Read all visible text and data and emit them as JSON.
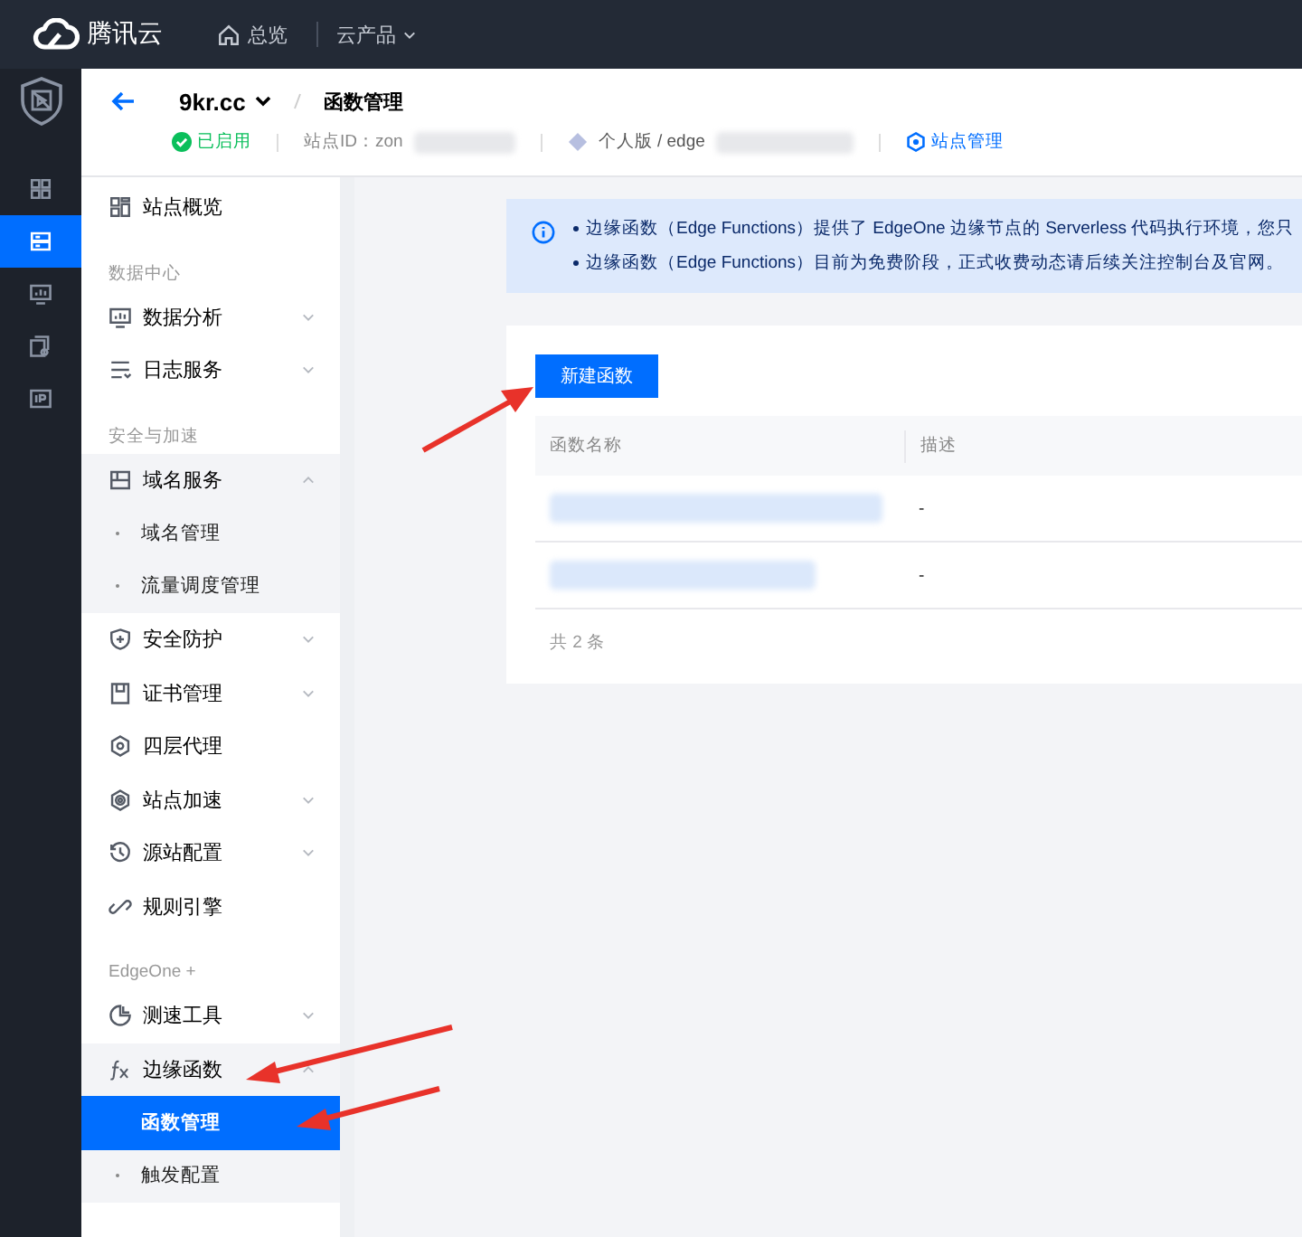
{
  "topbar": {
    "brand": "腾讯云",
    "nav": [
      {
        "label": "总览",
        "kind": "home"
      },
      {
        "label": "云产品",
        "kind": "dropdown"
      }
    ]
  },
  "header": {
    "site": "9kr.cc",
    "page": "函数管理",
    "status": "已启用",
    "zone_label": "站点ID：",
    "zone_id": "zon",
    "plan": "个人版 / edge",
    "manage_link": "站点管理"
  },
  "rail": [
    {
      "selected": false
    },
    {
      "selected": true
    },
    {
      "selected": false
    },
    {
      "selected": false
    },
    {
      "selected": false
    }
  ],
  "sidebar": [
    {
      "kind": "item",
      "label": "站点概览"
    },
    {
      "kind": "label",
      "label": "数据中心"
    },
    {
      "kind": "item",
      "label": "数据分析",
      "expanded": false
    },
    {
      "kind": "item",
      "label": "日志服务",
      "expanded": false
    },
    {
      "kind": "label",
      "label": "安全与加速"
    },
    {
      "kind": "item",
      "label": "域名服务",
      "expanded": true,
      "children": [
        {
          "label": "域名管理",
          "selected": false
        },
        {
          "label": "流量调度管理",
          "selected": false
        }
      ]
    },
    {
      "kind": "item",
      "label": "安全防护",
      "expanded": false
    },
    {
      "kind": "item",
      "label": "证书管理",
      "expanded": false
    },
    {
      "kind": "item",
      "label": "四层代理"
    },
    {
      "kind": "item",
      "label": "站点加速",
      "expanded": false
    },
    {
      "kind": "item",
      "label": "源站配置",
      "expanded": false
    },
    {
      "kind": "item",
      "label": "规则引擎"
    },
    {
      "kind": "label",
      "label": "EdgeOne +"
    },
    {
      "kind": "item",
      "label": "测速工具",
      "expanded": false
    },
    {
      "kind": "item",
      "label": "边缘函数",
      "expanded": true,
      "children": [
        {
          "label": "函数管理",
          "selected": true
        },
        {
          "label": "触发配置",
          "selected": false
        }
      ]
    }
  ],
  "notice": [
    "边缘函数（Edge Functions）提供了 EdgeOne 边缘节点的 Serverless 代码执行环境，您只",
    "边缘函数（Edge Functions）目前为免费阶段，正式收费动态请后续关注控制台及官网。"
  ],
  "create_button": "新建函数",
  "table": {
    "columns": [
      "函数名称",
      "描述"
    ],
    "rows": [
      {
        "description": "-"
      },
      {
        "description": "-"
      }
    ],
    "footer": "共 2 条"
  }
}
